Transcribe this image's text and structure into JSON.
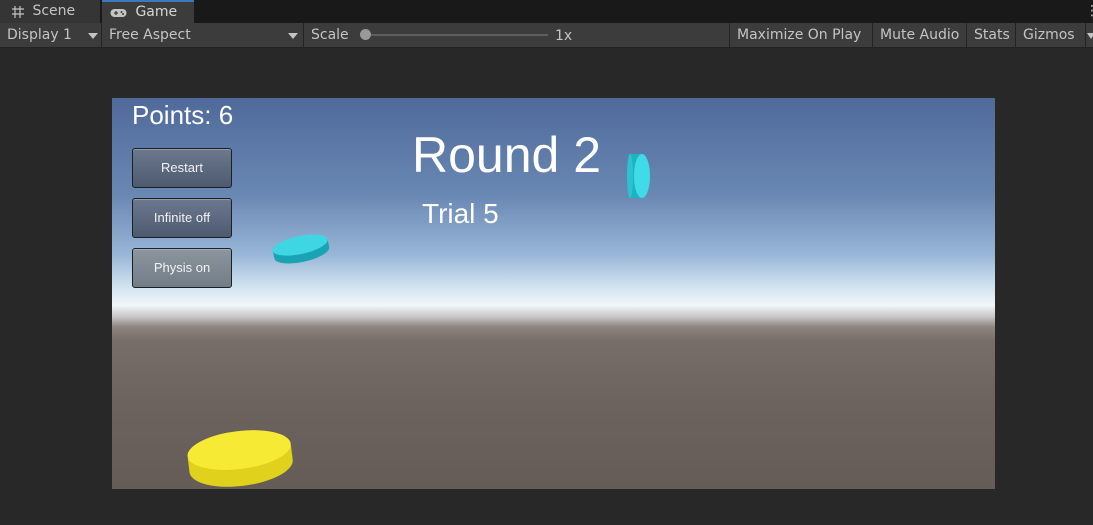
{
  "tabs": [
    {
      "label": "Scene",
      "icon": "grid-icon"
    },
    {
      "label": "Game",
      "icon": "gamepad-icon"
    }
  ],
  "toolbar": {
    "display": "Display 1",
    "aspect": "Free Aspect",
    "scale_label": "Scale",
    "scale_value": "1x",
    "maximize": "Maximize On Play",
    "mute": "Mute Audio",
    "stats": "Stats",
    "gizmos": "Gizmos"
  },
  "game": {
    "points": "Points: 6",
    "round": "Round 2",
    "trial": "Trial 5",
    "buttons": {
      "restart": "Restart",
      "infinite": "Infinite off",
      "physics": "Physis on"
    }
  },
  "colors": {
    "tab_active_accent": "#3a79bb",
    "disc_cyan": "#2ec8d6",
    "disc_yellow": "#f2e62a"
  }
}
